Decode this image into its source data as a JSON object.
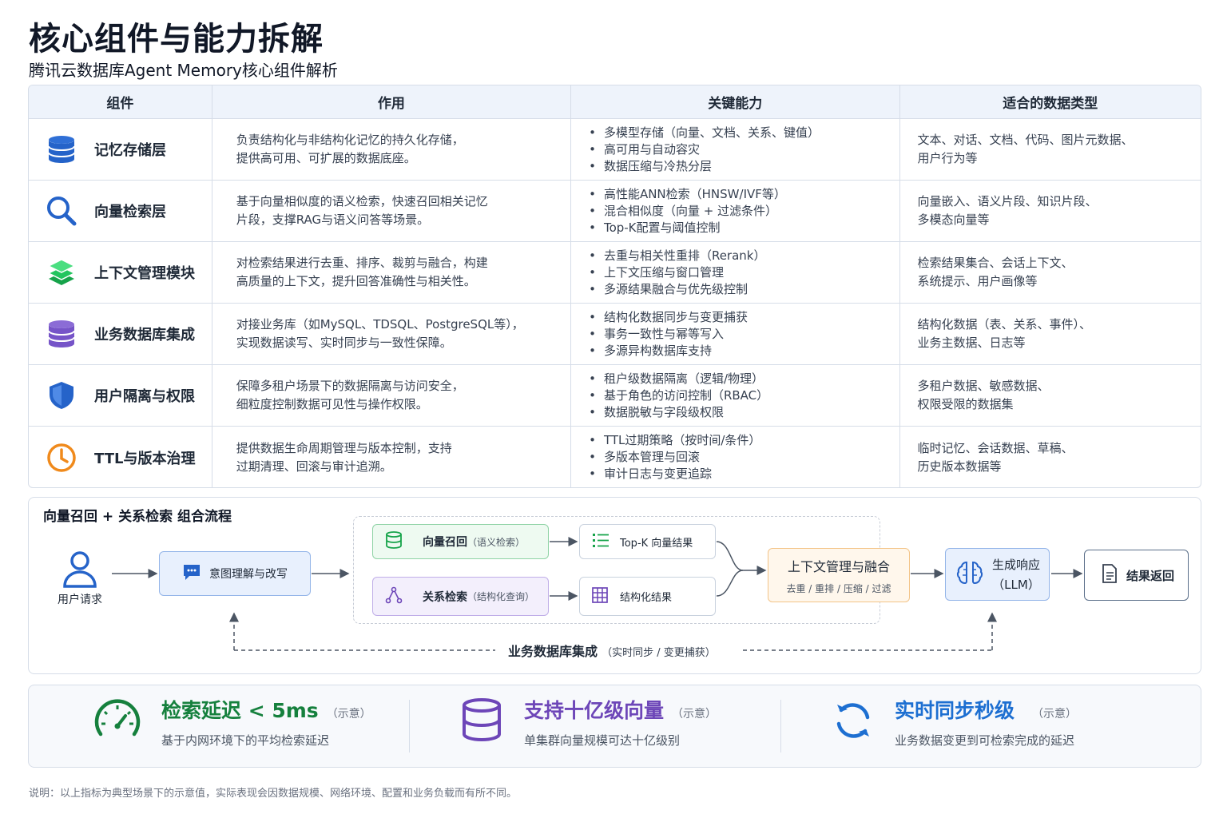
{
  "header": {
    "title": "核心组件与能力拆解",
    "subtitle": "腾讯云数据库Agent Memory核心组件解析"
  },
  "table": {
    "headers": [
      "组件",
      "作用",
      "关键能力",
      "适合的数据类型"
    ],
    "rows": [
      {
        "icon": "database-icon",
        "name": "记忆存储层",
        "role": [
          "负责结构化与非结构化记忆的持久化存储，",
          "提供高可用、可扩展的数据底座。"
        ],
        "capabilities": [
          "多模型存储（向量、文档、关系、键值）",
          "高可用与自动容灾",
          "数据压缩与冷热分层"
        ],
        "data_types": [
          "文本、对话、文档、代码、图片元数据、",
          "用户行为等"
        ]
      },
      {
        "icon": "search-icon",
        "name": "向量检索层",
        "role": [
          "基于向量相似度的语义检索，快速召回相关记忆",
          "片段，支撑RAG与语义问答等场景。"
        ],
        "capabilities": [
          "高性能ANN检索（HNSW/IVF等）",
          "混合相似度（向量 + 过滤条件）",
          "Top-K配置与阈值控制"
        ],
        "data_types": [
          "向量嵌入、语义片段、知识片段、",
          "多模态向量等"
        ]
      },
      {
        "icon": "layers-icon",
        "name": "上下文管理模块",
        "role": [
          "对检索结果进行去重、排序、裁剪与融合，构建",
          "高质量的上下文，提升回答准确性与相关性。"
        ],
        "capabilities": [
          "去重与相关性重排（Rerank）",
          "上下文压缩与窗口管理",
          "多源结果融合与优先级控制"
        ],
        "data_types": [
          "检索结果集合、会话上下文、",
          "系统提示、用户画像等"
        ]
      },
      {
        "icon": "database-purple-icon",
        "name": "业务数据库集成",
        "role": [
          "对接业务库（如MySQL、TDSQL、PostgreSQL等），",
          "实现数据读写、实时同步与一致性保障。"
        ],
        "capabilities": [
          "结构化数据同步与变更捕获",
          "事务一致性与幂等写入",
          "多源异构数据库支持"
        ],
        "data_types": [
          "结构化数据（表、关系、事件）、",
          "业务主数据、日志等"
        ]
      },
      {
        "icon": "shield-icon",
        "name": "用户隔离与权限",
        "role": [
          "保障多租户场景下的数据隔离与访问安全，",
          "细粒度控制数据可见性与操作权限。"
        ],
        "capabilities": [
          "租户级数据隔离（逻辑/物理）",
          "基于角色的访问控制（RBAC）",
          "数据脱敏与字段级权限"
        ],
        "data_types": [
          "多租户数据、敏感数据、",
          "权限受限的数据集"
        ]
      },
      {
        "icon": "clock-icon",
        "name": "TTL与版本治理",
        "role": [
          "提供数据生命周期管理与版本控制，支持",
          "过期清理、回滚与审计追溯。"
        ],
        "capabilities": [
          "TTL过期策略（按时间/条件）",
          "多版本管理与回滚",
          "审计日志与变更追踪"
        ],
        "data_types": [
          "临时记忆、会话数据、草稿、",
          "历史版本数据等"
        ]
      }
    ]
  },
  "flow": {
    "title": "向量召回 + 关系检索 组合流程",
    "user_label": "用户请求",
    "intent": "意图理解与改写",
    "vector_recall": "向量召回",
    "vector_recall_note": "（语义检索）",
    "relation_search": "关系检索",
    "relation_search_note": "（结构化查询）",
    "topk": "Top-K 向量结果",
    "structured": "结构化结果",
    "context_title": "上下文管理与融合",
    "context_sub": "去重 / 重排 / 压缩 / 过滤",
    "llm_line1": "生成响应",
    "llm_line2": "（LLM）",
    "result": "结果返回",
    "db_integration": "业务数据库集成",
    "db_integration_note": "（实时同步 / 变更捕获）"
  },
  "metrics": [
    {
      "title": "检索延迟 < 5ms",
      "note": "（示意）",
      "desc": "基于内网环境下的平均检索延迟",
      "color": "#15803d",
      "icon": "speedometer-icon"
    },
    {
      "title": "支持十亿级向量",
      "note": "（示意）",
      "desc": "单集群向量规模可达十亿级别",
      "color": "#6d46b8",
      "icon": "database-stack-icon"
    },
    {
      "title": "实时同步秒级",
      "note": "（示意）",
      "desc": "业务数据变更到可检索完成的延迟",
      "color": "#1d6fd1",
      "icon": "sync-icon"
    }
  ],
  "footnote": "说明：以上指标为典型场景下的示意值，实际表现会因数据规模、网络环境、配置和业务负载而有所不同。"
}
